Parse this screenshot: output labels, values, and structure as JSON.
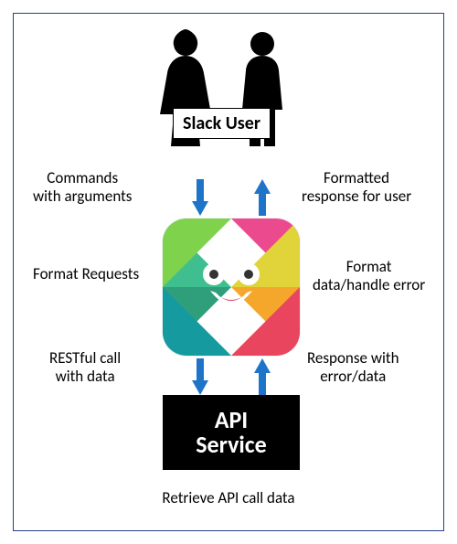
{
  "nodes": {
    "user_label": "Slack User",
    "api_line1": "API",
    "api_line2": "Service"
  },
  "edges": {
    "cmd_l1": "Commands",
    "cmd_l2": "with arguments",
    "fmt_resp_l1": "Formatted",
    "fmt_resp_l2": "response for user",
    "fmt_req": "Format Requests",
    "fmt_data_l1": "Format",
    "fmt_data_l2": "data/handle error",
    "rest_l1": "RESTful call",
    "rest_l2": "with data",
    "resp_l1": "Response with",
    "resp_l2": "error/data",
    "retrieve": "Retrieve API call data"
  }
}
